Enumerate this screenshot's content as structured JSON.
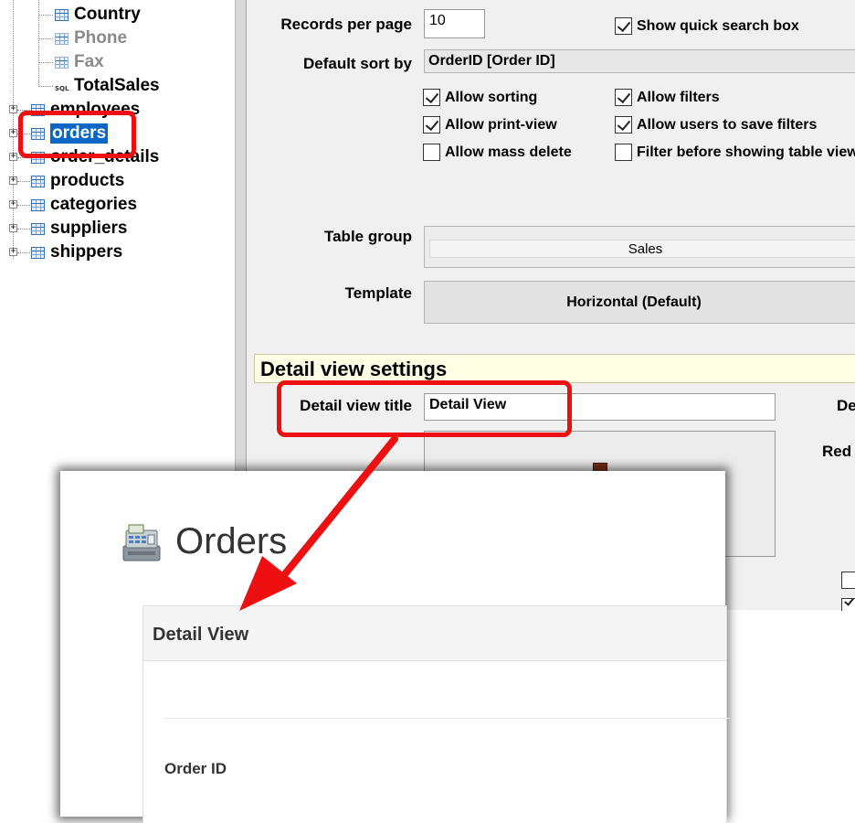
{
  "tree": {
    "fields": [
      {
        "label": "Country",
        "kind": "table",
        "dim": false
      },
      {
        "label": "Phone",
        "kind": "table",
        "dim": true
      },
      {
        "label": "Fax",
        "kind": "table",
        "dim": true
      },
      {
        "label": "TotalSales",
        "kind": "sql",
        "dim": false
      }
    ],
    "sql_icon_text": "SQL",
    "tables": [
      {
        "label": "employees",
        "selected": false
      },
      {
        "label": "orders",
        "selected": true
      },
      {
        "label": "order_details",
        "selected": false
      },
      {
        "label": "products",
        "selected": false
      },
      {
        "label": "categories",
        "selected": false
      },
      {
        "label": "suppliers",
        "selected": false
      },
      {
        "label": "shippers",
        "selected": false
      }
    ],
    "expander_glyph": "+"
  },
  "settings": {
    "records_per_page_label": "Records per page",
    "records_per_page_value": "10",
    "show_quick_search_label": "Show quick search box",
    "show_quick_search_checked": true,
    "default_sort_label": "Default sort by",
    "default_sort_value": "OrderID [Order ID]",
    "checkboxes": [
      {
        "label": "Allow sorting",
        "checked": true
      },
      {
        "label": "Allow filters",
        "checked": true
      },
      {
        "label": "Allow print-view",
        "checked": true
      },
      {
        "label": "Allow users to save filters",
        "checked": true
      },
      {
        "label": "Allow mass delete",
        "checked": false
      },
      {
        "label": "Filter before showing table view",
        "checked": false
      }
    ],
    "table_group_label": "Table group",
    "table_group_value": "Sales",
    "template_label": "Template",
    "template_value": "Horizontal (Default)",
    "detail_section_title": "Detail view settings",
    "detail_view_title_label": "Detail view title",
    "detail_view_title_value": "Detail View",
    "right_partial_1": "De",
    "right_partial_2": "Red"
  },
  "preview": {
    "page_title": "Orders",
    "card_title": "Detail View",
    "field_label": "Order ID"
  },
  "colors": {
    "callout": "#ee1010",
    "selection": "#0a67c4",
    "section_bg": "#ffffe6"
  }
}
